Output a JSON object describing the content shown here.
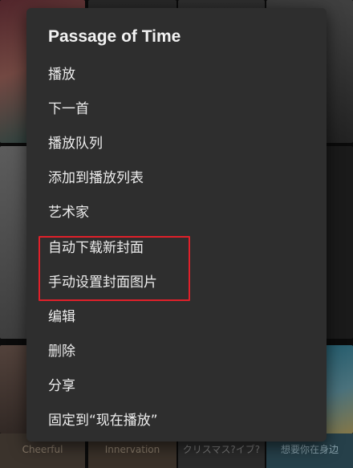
{
  "menu": {
    "title": "Passage of Time",
    "items": [
      {
        "label": "播放"
      },
      {
        "label": "下一首"
      },
      {
        "label": "播放队列"
      },
      {
        "label": "添加到播放列表"
      },
      {
        "label": "艺术家"
      },
      {
        "label": "自动下载新封面"
      },
      {
        "label": "手动设置封面图片"
      },
      {
        "label": "编辑"
      },
      {
        "label": "删除"
      },
      {
        "label": "分享"
      },
      {
        "label": "固定到“现在播放”"
      }
    ],
    "highlight_color": "#e0202a"
  },
  "background": {
    "album_labels": [
      "Cheerful",
      "Innervation",
      "クリスマス?イブ?",
      "想要你在身边"
    ]
  }
}
